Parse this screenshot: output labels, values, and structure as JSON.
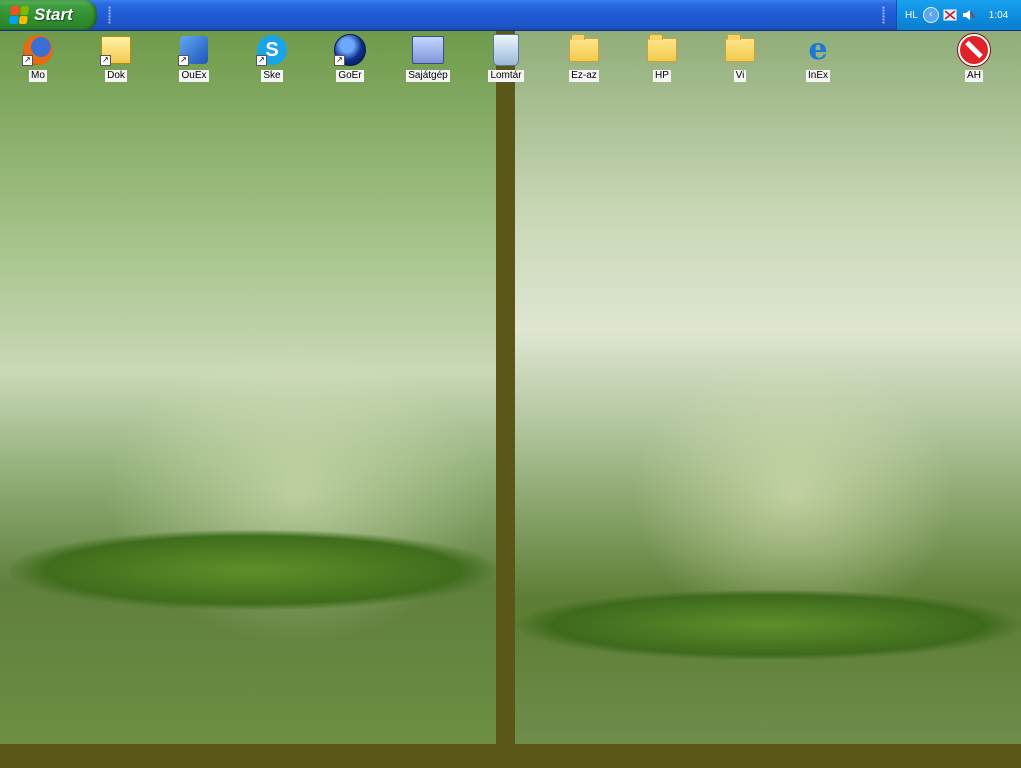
{
  "taskbar": {
    "start_label": "Start",
    "tray": {
      "language": "HL",
      "expand_glyph": "‹",
      "clock": "1:04"
    }
  },
  "desktop_icons": [
    {
      "label": "Mo",
      "icon": "firefox-icon",
      "shortcut": true
    },
    {
      "label": "Dok",
      "icon": "documents-folder-icon",
      "shortcut": true
    },
    {
      "label": "OuEx",
      "icon": "outlook-express-icon",
      "shortcut": true
    },
    {
      "label": "Ske",
      "icon": "skype-icon",
      "shortcut": true
    },
    {
      "label": "GoEr",
      "icon": "google-earth-icon",
      "shortcut": true
    },
    {
      "label": "Sajátgép",
      "icon": "my-computer-icon",
      "shortcut": false
    },
    {
      "label": "Lomtár",
      "icon": "recycle-bin-icon",
      "shortcut": false
    },
    {
      "label": "Ez-az",
      "icon": "folder-icon",
      "shortcut": false
    },
    {
      "label": "HP",
      "icon": "folder-icon",
      "shortcut": false
    },
    {
      "label": "Vi",
      "icon": "folder-icon",
      "shortcut": false
    },
    {
      "label": "InEx",
      "icon": "internet-explorer-icon",
      "shortcut": false
    },
    {
      "label": "AH",
      "icon": "no-entry-icon",
      "shortcut": false
    }
  ],
  "colors": {
    "taskbar_blue": "#1f5bd6",
    "start_green": "#3f9d3f",
    "tray_blue": "#0f8ee0",
    "wallpaper_divider": "#5b5719"
  }
}
